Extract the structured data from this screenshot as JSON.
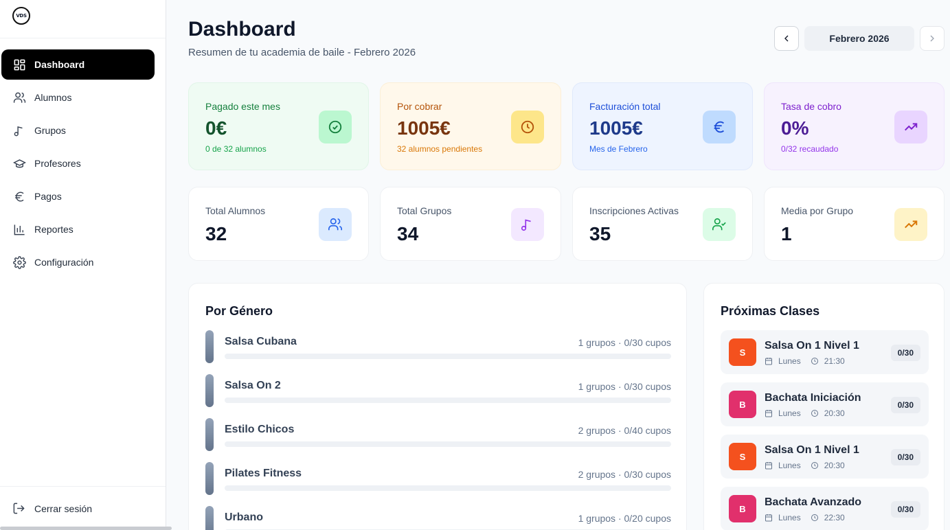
{
  "sidebar": {
    "logo_text": "VDS",
    "items": [
      {
        "label": "Dashboard",
        "icon": "dashboard-icon",
        "active": true
      },
      {
        "label": "Alumnos",
        "icon": "users-icon",
        "active": false
      },
      {
        "label": "Grupos",
        "icon": "music-note-icon",
        "active": false
      },
      {
        "label": "Profesores",
        "icon": "graduation-cap-icon",
        "active": false
      },
      {
        "label": "Pagos",
        "icon": "euro-icon",
        "active": false
      },
      {
        "label": "Reportes",
        "icon": "bar-chart-icon",
        "active": false
      },
      {
        "label": "Configuración",
        "icon": "gear-icon",
        "active": false
      }
    ],
    "logout_label": "Cerrar sesión"
  },
  "header": {
    "title": "Dashboard",
    "subtitle": "Resumen de tu academia de baile - Febrero 2026",
    "month": "Febrero 2026"
  },
  "finance_cards": [
    {
      "label": "Pagado este mes",
      "value": "0€",
      "note": "0 de 32 alumnos",
      "icon": "check-circle-icon",
      "accent": "#15803d",
      "bg": "#effbf3",
      "badge_bg": "#bbf7d0"
    },
    {
      "label": "Por cobrar",
      "value": "1005€",
      "note": "32 alumnos pendientes",
      "icon": "clock-icon",
      "accent": "#b45309",
      "bg": "#fff8eb",
      "badge_bg": "#fde68a"
    },
    {
      "label": "Facturación total",
      "value": "1005€",
      "note": "Mes de Febrero",
      "icon": "euro-icon",
      "accent": "#1d4ed8",
      "bg": "#eef4ff",
      "badge_bg": "#bfdbfe"
    },
    {
      "label": "Tasa de cobro",
      "value": "0%",
      "note": "0/32 recaudado",
      "icon": "trending-up-icon",
      "accent": "#7e22ce",
      "bg": "#f7f2fe",
      "badge_bg": "#e9d5ff"
    }
  ],
  "summary_cards": [
    {
      "label": "Total Alumnos",
      "value": "32",
      "icon": "users-icon",
      "icon_color": "#2563eb",
      "badge_bg": "#dbeafe"
    },
    {
      "label": "Total Grupos",
      "value": "34",
      "icon": "music-note-icon",
      "icon_color": "#9333ea",
      "badge_bg": "#f3e8ff"
    },
    {
      "label": "Inscripciones Activas",
      "value": "35",
      "icon": "user-check-icon",
      "icon_color": "#16a34a",
      "badge_bg": "#dcfce7"
    },
    {
      "label": "Media por Grupo",
      "value": "1",
      "icon": "trending-up-icon",
      "icon_color": "#d97706",
      "badge_bg": "#fef3c7"
    }
  ],
  "genres": {
    "title": "Por Género",
    "items": [
      {
        "name": "Salsa Cubana",
        "meta": "1 grupos · 0/30 cupos",
        "fill": 0
      },
      {
        "name": "Salsa On 2",
        "meta": "1 grupos · 0/30 cupos",
        "fill": 0
      },
      {
        "name": "Estilo Chicos",
        "meta": "2 grupos · 0/40 cupos",
        "fill": 0
      },
      {
        "name": "Pilates Fitness",
        "meta": "2 grupos · 0/30 cupos",
        "fill": 0
      },
      {
        "name": "Urbano",
        "meta": "1 grupos · 0/20 cupos",
        "fill": 0
      }
    ]
  },
  "classes": {
    "title": "Próximas Clases",
    "items": [
      {
        "initial": "S",
        "name": "Salsa On 1 Nivel 1",
        "day": "Lunes",
        "time": "21:30",
        "capacity": "0/30",
        "color": "#f4511e"
      },
      {
        "initial": "B",
        "name": "Bachata Iniciación",
        "day": "Lunes",
        "time": "20:30",
        "capacity": "0/30",
        "color": "#e1306c"
      },
      {
        "initial": "S",
        "name": "Salsa On 1 Nivel 1",
        "day": "Lunes",
        "time": "20:30",
        "capacity": "0/30",
        "color": "#f4511e"
      },
      {
        "initial": "B",
        "name": "Bachata Avanzado",
        "day": "Lunes",
        "time": "22:30",
        "capacity": "0/30",
        "color": "#e1306c"
      }
    ]
  }
}
